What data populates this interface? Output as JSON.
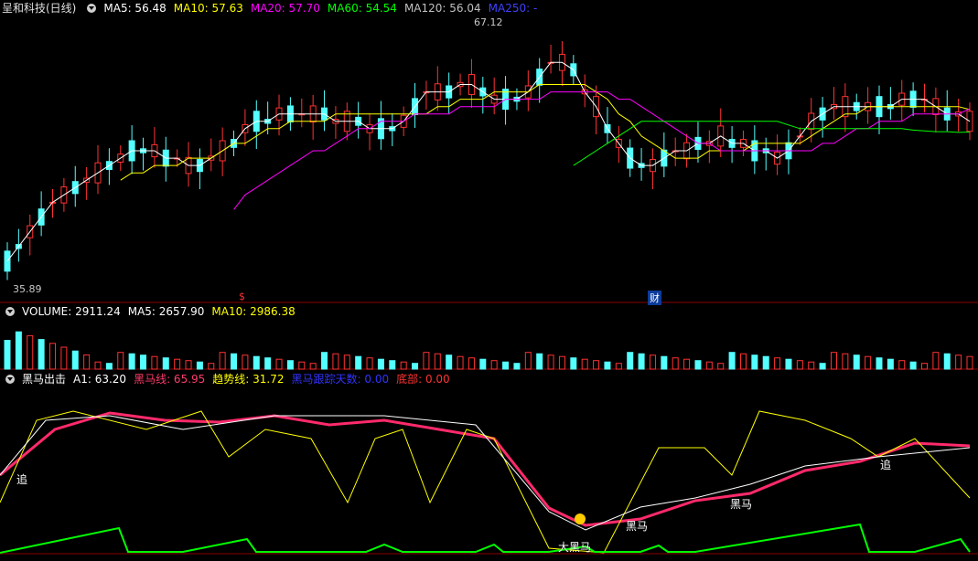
{
  "main": {
    "title": "呈和科技(日线)",
    "ma": [
      {
        "label": "MA5: 56.48",
        "color": "#ffffff"
      },
      {
        "label": "MA10: 57.63",
        "color": "#ffff00"
      },
      {
        "label": "MA20: 57.70",
        "color": "#ff00ff"
      },
      {
        "label": "MA60: 54.54",
        "color": "#00ff00"
      },
      {
        "label": "MA120: 56.04",
        "color": "#c0c0c0"
      },
      {
        "label": "MA250: -",
        "color": "#4040ff"
      }
    ],
    "high_label": "67.12",
    "low_label": "35.89",
    "marker_dollar": "$",
    "marker_fin": "财",
    "ylim": [
      34,
      70
    ]
  },
  "volume_panel": {
    "labels": [
      {
        "label": "VOLUME: 2911.24",
        "color": "#ffffff"
      },
      {
        "label": "MA5: 2657.90",
        "color": "#ffffff"
      },
      {
        "label": "MA10: 2986.38",
        "color": "#ffff00"
      }
    ]
  },
  "indicator_panel": {
    "labels": [
      {
        "label": "黑马出击",
        "color": "#ffffff"
      },
      {
        "label": "A1: 63.20",
        "color": "#ffffff"
      },
      {
        "label": "黑马线: 65.95",
        "color": "#ff3b6b"
      },
      {
        "label": "趋势线: 31.72",
        "color": "#ffff00"
      },
      {
        "label": "黑马跟踪天数: 0.00",
        "color": "#3333ff"
      },
      {
        "label": "底部: 0.00",
        "color": "#ff3333"
      }
    ],
    "annotations": {
      "zhui": "追",
      "big_horse": "大黑马",
      "horse": "黑马"
    }
  },
  "colors": {
    "up": "#ff3232",
    "down": "#54ffff",
    "grid": "#8b0000"
  },
  "chart_data": {
    "type": "candlestick",
    "series": [
      {
        "name": "MA5",
        "values": [
          37,
          39,
          41,
          43,
          45,
          46,
          47,
          48,
          49,
          50,
          51,
          52,
          52,
          52,
          51,
          51,
          50,
          50,
          51,
          52,
          53,
          55,
          56,
          56,
          57,
          57,
          57,
          57,
          57,
          56,
          56,
          56,
          55,
          55,
          55,
          56,
          58,
          60,
          60,
          60,
          61,
          61,
          60,
          59,
          59,
          59,
          60,
          62,
          64,
          64,
          63,
          60,
          58,
          55,
          53,
          51,
          50,
          50,
          51,
          52,
          52,
          53,
          53,
          54,
          53,
          53,
          52,
          52,
          51,
          52,
          54,
          56,
          57,
          58,
          58,
          58,
          58,
          58,
          58,
          59,
          59,
          59,
          58,
          57,
          57,
          56
        ]
      },
      {
        "name": "MA10",
        "values": [
          null,
          null,
          null,
          null,
          null,
          null,
          null,
          null,
          null,
          null,
          48,
          49,
          49,
          50,
          50,
          50,
          51,
          51,
          51,
          52,
          53,
          53,
          54,
          55,
          55,
          56,
          56,
          56,
          56,
          57,
          57,
          57,
          57,
          57,
          57,
          57,
          57,
          57,
          58,
          58,
          59,
          59,
          59,
          60,
          60,
          60,
          60,
          61,
          61,
          61,
          61,
          61,
          60,
          59,
          57,
          56,
          54,
          53,
          52,
          51,
          51,
          51,
          52,
          52,
          52,
          52,
          53,
          53,
          53,
          53,
          53,
          54,
          55,
          56,
          57,
          57,
          58,
          58,
          58,
          58,
          58,
          58,
          58,
          58,
          58,
          57.6
        ]
      },
      {
        "name": "MA20",
        "values": [
          null,
          null,
          null,
          null,
          null,
          null,
          null,
          null,
          null,
          null,
          null,
          null,
          null,
          null,
          null,
          null,
          null,
          null,
          null,
          null,
          44,
          46,
          47,
          48,
          49,
          50,
          51,
          52,
          52,
          53,
          54,
          55,
          55,
          56,
          56,
          56,
          57,
          57,
          57,
          57,
          58,
          58,
          58,
          58,
          59,
          59,
          59,
          59,
          60,
          60,
          60,
          60,
          60,
          60,
          59,
          59,
          58,
          57,
          56,
          55,
          54,
          53,
          53,
          52,
          52,
          52,
          52,
          52,
          52,
          52,
          52,
          52,
          53,
          53,
          54,
          55,
          55,
          56,
          56,
          56,
          57,
          57,
          57,
          57,
          57,
          57.7
        ]
      },
      {
        "name": "MA60",
        "values": [
          null,
          null,
          null,
          null,
          null,
          null,
          null,
          null,
          null,
          null,
          null,
          null,
          null,
          null,
          null,
          null,
          null,
          null,
          null,
          null,
          null,
          null,
          null,
          null,
          null,
          null,
          null,
          null,
          null,
          null,
          null,
          null,
          null,
          null,
          null,
          null,
          null,
          null,
          null,
          null,
          null,
          null,
          null,
          null,
          null,
          null,
          null,
          null,
          null,
          null,
          50,
          51,
          52,
          53,
          54,
          55,
          56,
          56,
          56,
          56,
          56,
          56,
          56,
          56,
          56,
          56,
          56,
          56,
          56,
          55.5,
          55,
          55,
          55,
          55,
          55,
          55,
          55,
          55,
          55,
          55,
          54.8,
          54.7,
          54.6,
          54.6,
          54.5,
          54.54
        ]
      }
    ],
    "title": "",
    "xlabel": "",
    "ylabel": ""
  }
}
